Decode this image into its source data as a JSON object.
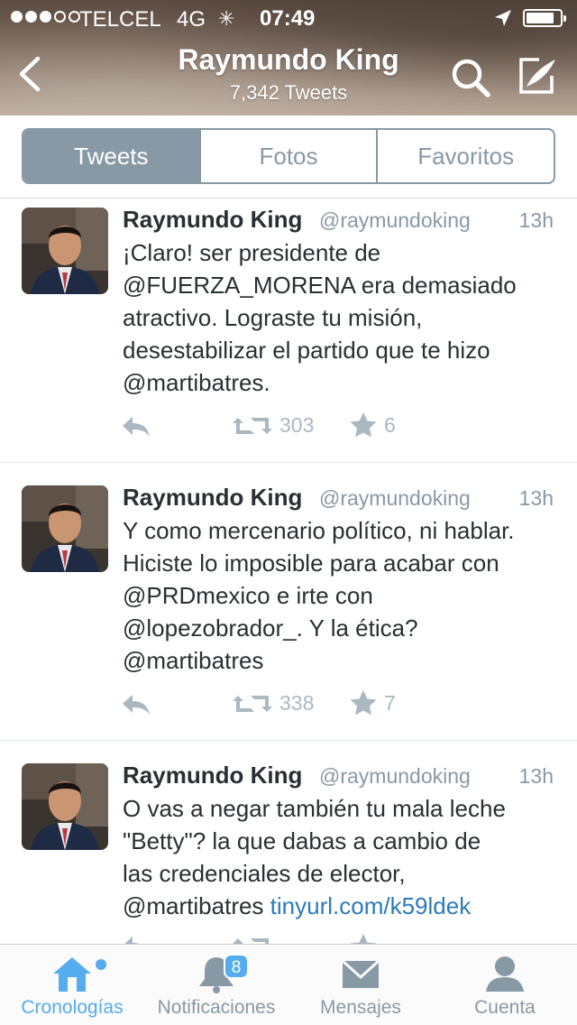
{
  "status_bar": {
    "carrier": "TELCEL",
    "network": "4G",
    "time": "07:49"
  },
  "header": {
    "title": "Raymundo King",
    "subtitle": "7,342 Tweets"
  },
  "segments": [
    {
      "label": "Tweets",
      "active": true
    },
    {
      "label": "Fotos",
      "active": false
    },
    {
      "label": "Favoritos",
      "active": false
    }
  ],
  "tweets": [
    {
      "name": "Raymundo King",
      "handle": "@raymundoking",
      "time": "13h",
      "lines": [
        "¡Claro! ser presidente de",
        "@FUERZA_MORENA era demasiado",
        "atractivo. Lograste tu misión,",
        "desestabilizar el partido que te hizo",
        "@martibatres."
      ],
      "retweets": "303",
      "favorites": "6"
    },
    {
      "name": "Raymundo King",
      "handle": "@raymundoking",
      "time": "13h",
      "lines": [
        "Y como mercenario político, ni hablar.",
        "Hiciste lo imposible para acabar con",
        "@PRDmexico e irte con",
        "@lopezobrador_. Y la ética?",
        "@martibatres"
      ],
      "retweets": "338",
      "favorites": "7"
    },
    {
      "name": "Raymundo King",
      "handle": "@raymundoking",
      "time": "13h",
      "lines": [
        "O vas a negar también tu mala leche",
        "\"Betty\"? la que dabas a cambio de",
        "las credenciales de elector,",
        "@martibatres"
      ],
      "link": "tinyurl.com/k59ldek"
    }
  ],
  "tabbar": {
    "items": [
      {
        "label": "Cronologías",
        "icon": "home-icon",
        "active": true
      },
      {
        "label": "Notificaciones",
        "icon": "bell-icon",
        "badge": "8"
      },
      {
        "label": "Mensajes",
        "icon": "envelope-icon"
      },
      {
        "label": "Cuenta",
        "icon": "person-icon"
      }
    ]
  },
  "colors": {
    "accent": "#55acee",
    "muted": "#8899a6",
    "link": "#2b7bb9"
  }
}
